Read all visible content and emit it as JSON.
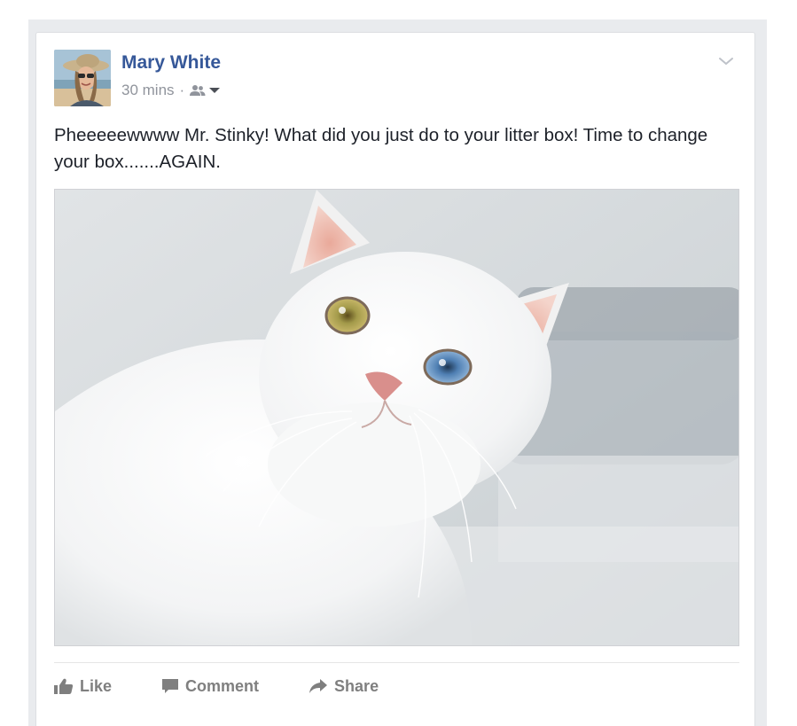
{
  "post": {
    "author": "Mary White",
    "time": "30 mins",
    "separator": "·",
    "audience_icon": "friends-icon",
    "text": "Pheeeeewwww Mr. Stinky! What did you just do to your litter box! Time to change your box.......AGAIN.",
    "photo_subject": "white-cat-heterochromia"
  },
  "actions": {
    "like_label": "Like",
    "comment_label": "Comment",
    "share_label": "Share"
  },
  "colors": {
    "author_link": "#365899",
    "meta_text": "#90949c",
    "action_text": "#7f7f7f",
    "feed_background": "#e9ebee"
  }
}
